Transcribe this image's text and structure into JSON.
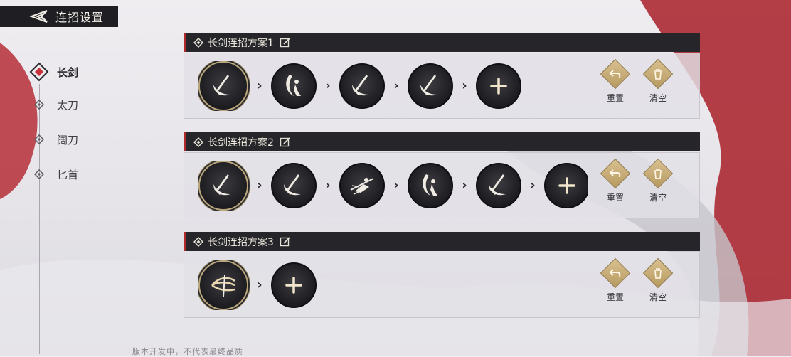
{
  "header": {
    "title": "连招设置"
  },
  "sidebar": {
    "items": [
      {
        "label": "长剑",
        "active": true
      },
      {
        "label": "太刀",
        "active": false
      },
      {
        "label": "阔刀",
        "active": false
      },
      {
        "label": "匕首",
        "active": false
      }
    ]
  },
  "plans": [
    {
      "name": "长剑连招方案1",
      "reset": "重置",
      "clear": "清空",
      "skills": [
        "sword-slash-icon",
        "sword-flourish-icon",
        "sword-slash-icon",
        "sword-slash-icon",
        "add-icon"
      ]
    },
    {
      "name": "长剑连招方案2",
      "reset": "重置",
      "clear": "清空",
      "skills": [
        "sword-slash-icon",
        "sword-slash-icon",
        "dash-strike-icon",
        "sword-flourish-icon",
        "sword-slash-icon",
        "add-icon"
      ]
    },
    {
      "name": "长剑连招方案3",
      "reset": "重置",
      "clear": "清空",
      "skills": [
        "triple-blade-icon",
        "add-icon"
      ]
    }
  ],
  "footer": {
    "note": "版本开发中，不代表最终品质"
  },
  "colors": {
    "accent_red": "#b12a2a",
    "gold": "#c4a970",
    "dark": "#1f1f23"
  }
}
